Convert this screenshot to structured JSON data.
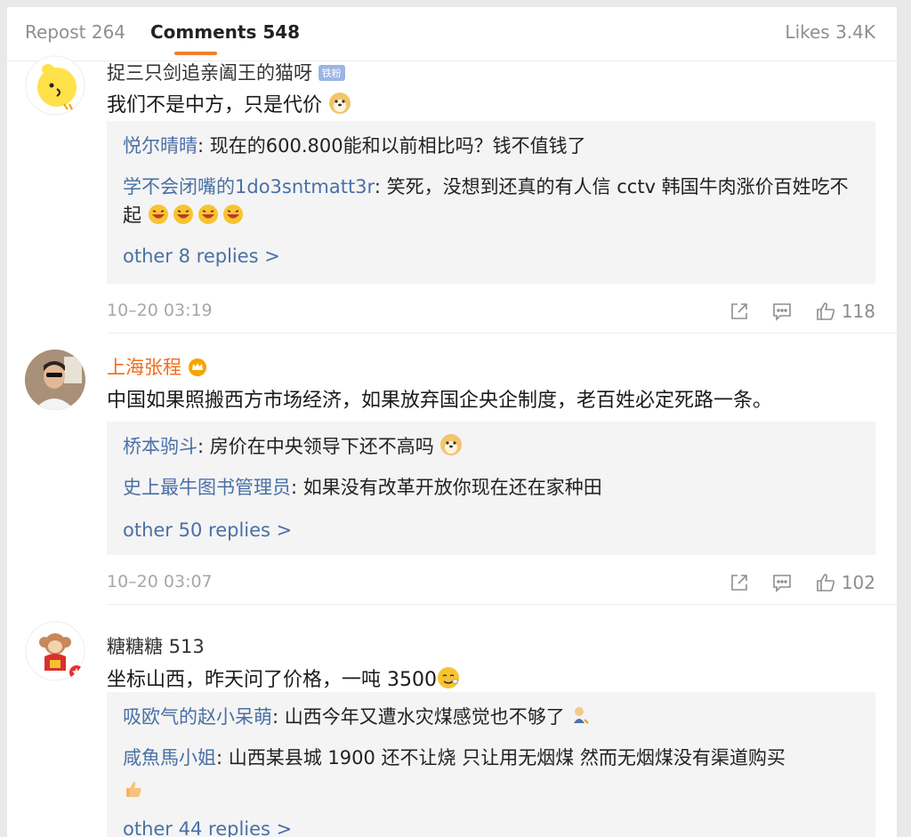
{
  "tabs": {
    "repost": "Repost 264",
    "comments": "Comments 548",
    "likes": "Likes 3.4K"
  },
  "colors": {
    "accent": "#f08031",
    "link": "#4a70a6",
    "vip_name": "#f36b1c"
  },
  "comments": [
    {
      "user": "捉三只剑追亲阖王的猫呀",
      "badge": "铁粉",
      "text": "我们不是中方，只是代价",
      "replies": [
        {
          "user": "悦尔晴晴",
          "text": ": 现在的600.800能和以前相比吗？钱不值钱了"
        },
        {
          "user": "学不会闭嘴的1do3sntmatt3r",
          "text": ": 笑死，没想到还真的有人信 cctv 韩国牛肉涨价百姓吃不起"
        }
      ],
      "more": "other 8 replies >",
      "time": "10–20 03:19",
      "likes": "118"
    },
    {
      "user": "上海张程",
      "text": "中国如果照搬西方市场经济，如果放弃国企央企制度，老百姓必定死路一条。",
      "replies": [
        {
          "user": "桥本驹斗",
          "text": ": 房价在中央领导下还不高吗"
        },
        {
          "user": "史上最牛图书管理员",
          "text": ": 如果没有改革开放你现在还在家种田"
        }
      ],
      "more": "other 50 replies >",
      "time": "10–20 03:07",
      "likes": "102"
    },
    {
      "user": "糖糖糖 513",
      "text": "坐标山西，昨天问了价格，一吨 3500",
      "replies": [
        {
          "user": "吸欧气的赵小呆萌",
          "text": ": 山西今年又遭水灾煤感觉也不够了"
        },
        {
          "user": "咸魚馬小姐",
          "text": ": 山西某县城 1900 还不让烧 只让用无烟煤 然而无烟煤没有渠道购买"
        }
      ],
      "more": "other 44 replies >"
    }
  ]
}
